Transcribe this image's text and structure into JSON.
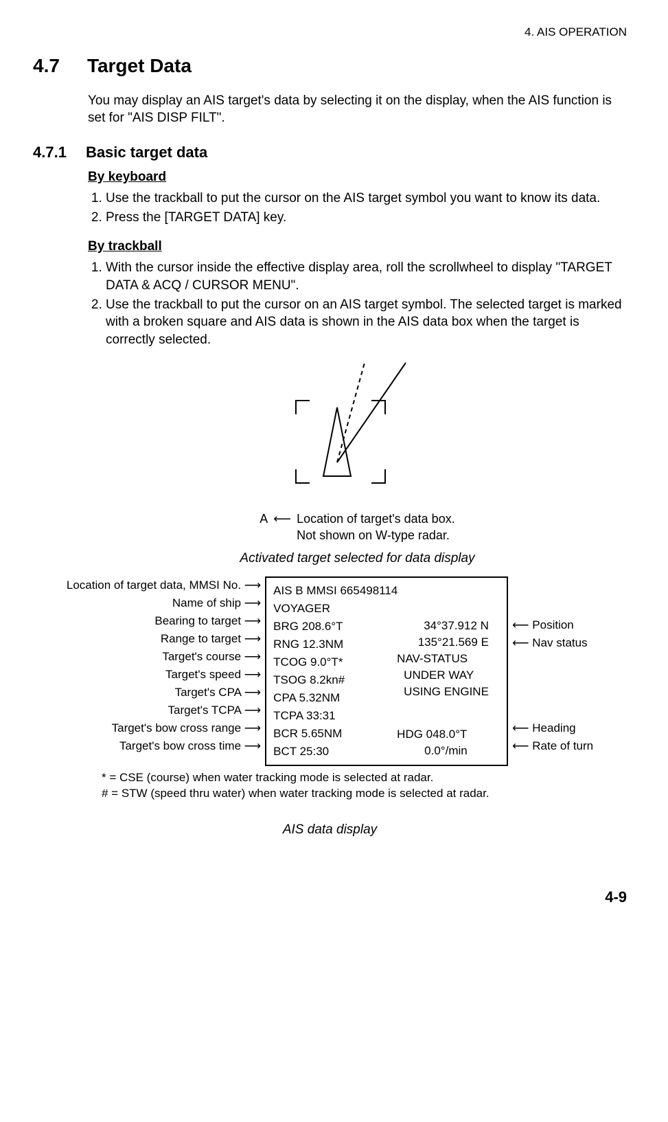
{
  "running_head": "4. AIS OPERATION",
  "sec": {
    "num": "4.7",
    "title": "Target Data"
  },
  "intro": "You may display an AIS target's data by selecting it on the display, when the AIS function is set for \"AIS DISP FILT\".",
  "subsec": {
    "num": "4.7.1",
    "title": "Basic target data"
  },
  "by_keyboard": {
    "heading": "By keyboard",
    "steps": [
      "Use the trackball to put the cursor on the AIS target symbol you want to know its data.",
      "Press the [TARGET DATA] key."
    ]
  },
  "by_trackball": {
    "heading": "By trackball",
    "steps": [
      "With the cursor inside the effective display area, roll the scrollwheel to display \"TARGET DATA & ACQ / CURSOR MENU\".",
      "Use the trackball to put the cursor on an AIS target symbol. The selected target is marked with a broken square and AIS data is shown in the AIS data box when the target is correctly selected."
    ]
  },
  "fig1": {
    "marker": "A",
    "caption_line1": "Location of target's data box.",
    "caption_line2": "Not shown on W-type radar.",
    "title": "Activated target selected for data display"
  },
  "callouts_left": [
    "Location of target data, MMSI No.",
    "Name of ship",
    "Bearing to target",
    "Range to target",
    "Target's course",
    "Target's speed",
    "Target's CPA",
    "Target's TCPA",
    "Target's bow cross range",
    "Target's bow cross time"
  ],
  "databox": {
    "line_ais": "AIS  B     MMSI 665498114",
    "line_name": "VOYAGER",
    "line_brg": "BRG  208.6°T",
    "line_rng": "RNG 12.3NM",
    "line_cog": "TCOG 9.0°T*",
    "line_sog": "TSOG 8.2kn#",
    "line_cpa": "CPA 5.32NM",
    "line_tcpa": "TCPA 33:31",
    "line_bcr": "BCR 5.65NM",
    "line_bct": "BCT  25:30",
    "pos_lat": "34°37.912 N",
    "pos_lon": "135°21.569 E",
    "nav_label": "NAV-STATUS",
    "nav_1": "UNDER WAY",
    "nav_2": "USING ENGINE",
    "hdg": "HDG 048.0°T",
    "rot": "0.0°/min"
  },
  "callouts_right": {
    "position": "Position",
    "navstatus": "Nav status",
    "heading": "Heading",
    "rot": "Rate of turn"
  },
  "footnote1": "* = CSE (course) when water tracking mode is selected at radar.",
  "footnote2": "# = STW (speed thru water) when water tracking mode is selected at radar.",
  "fig2_title": "AIS data display",
  "page_number": "4-9"
}
